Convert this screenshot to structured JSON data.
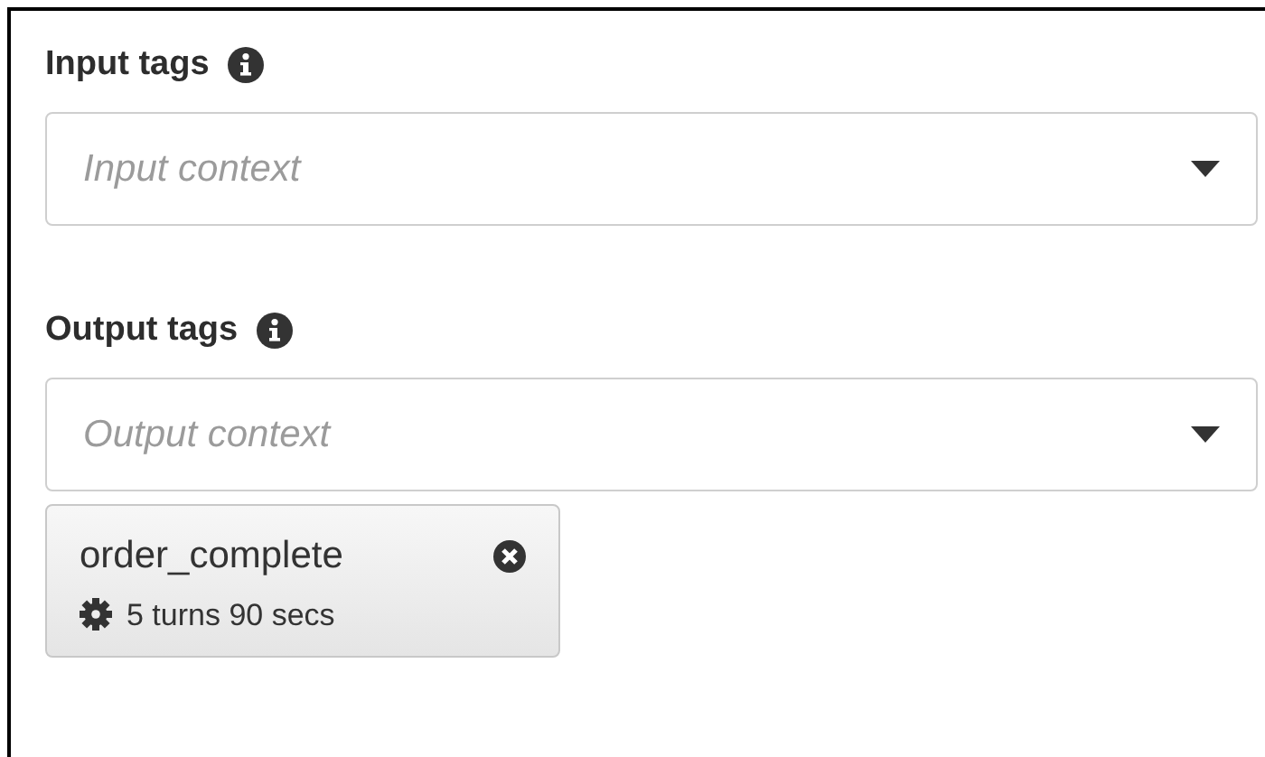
{
  "sections": [
    {
      "label": "Input tags",
      "placeholder": "Input context"
    },
    {
      "label": "Output tags",
      "placeholder": "Output context",
      "tags": [
        {
          "name": "order_complete",
          "detail": "5 turns 90 secs"
        }
      ]
    }
  ]
}
